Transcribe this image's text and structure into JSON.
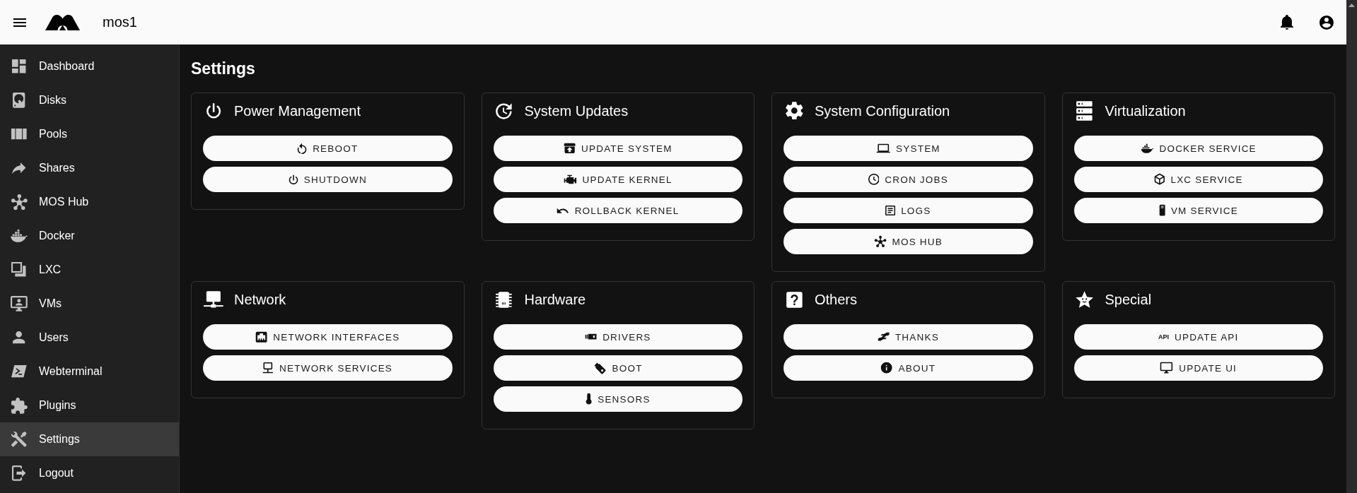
{
  "header": {
    "title": "mos1"
  },
  "sidebar": {
    "items": [
      {
        "label": "Dashboard",
        "selected": false
      },
      {
        "label": "Disks",
        "selected": false
      },
      {
        "label": "Pools",
        "selected": false
      },
      {
        "label": "Shares",
        "selected": false
      },
      {
        "label": "MOS Hub",
        "selected": false
      },
      {
        "label": "Docker",
        "selected": false
      },
      {
        "label": "LXC",
        "selected": false
      },
      {
        "label": "VMs",
        "selected": false
      },
      {
        "label": "Users",
        "selected": false
      },
      {
        "label": "Webterminal",
        "selected": false
      },
      {
        "label": "Plugins",
        "selected": false
      },
      {
        "label": "Settings",
        "selected": true
      },
      {
        "label": "Logout",
        "selected": false
      }
    ]
  },
  "page": {
    "title": "Settings"
  },
  "cards": [
    {
      "title": "Power Management",
      "buttons": [
        {
          "label": "REBOOT"
        },
        {
          "label": "SHUTDOWN"
        }
      ]
    },
    {
      "title": "System Updates",
      "buttons": [
        {
          "label": "UPDATE SYSTEM"
        },
        {
          "label": "UPDATE KERNEL"
        },
        {
          "label": "ROLLBACK KERNEL"
        }
      ]
    },
    {
      "title": "System Configuration",
      "buttons": [
        {
          "label": "SYSTEM"
        },
        {
          "label": "CRON JOBS"
        },
        {
          "label": "LOGS"
        },
        {
          "label": "MOS HUB"
        }
      ]
    },
    {
      "title": "Virtualization",
      "buttons": [
        {
          "label": "DOCKER SERVICE"
        },
        {
          "label": "LXC SERVICE"
        },
        {
          "label": "VM SERVICE"
        }
      ]
    },
    {
      "title": "Network",
      "buttons": [
        {
          "label": "NETWORK INTERFACES"
        },
        {
          "label": "NETWORK SERVICES"
        }
      ]
    },
    {
      "title": "Hardware",
      "buttons": [
        {
          "label": "DRIVERS"
        },
        {
          "label": "BOOT"
        },
        {
          "label": "SENSORS"
        }
      ]
    },
    {
      "title": "Others",
      "buttons": [
        {
          "label": "THANKS"
        },
        {
          "label": "ABOUT"
        }
      ]
    },
    {
      "title": "Special",
      "buttons": [
        {
          "label": "UPDATE API",
          "icon_text": "API"
        },
        {
          "label": "UPDATE UI"
        }
      ]
    }
  ]
}
